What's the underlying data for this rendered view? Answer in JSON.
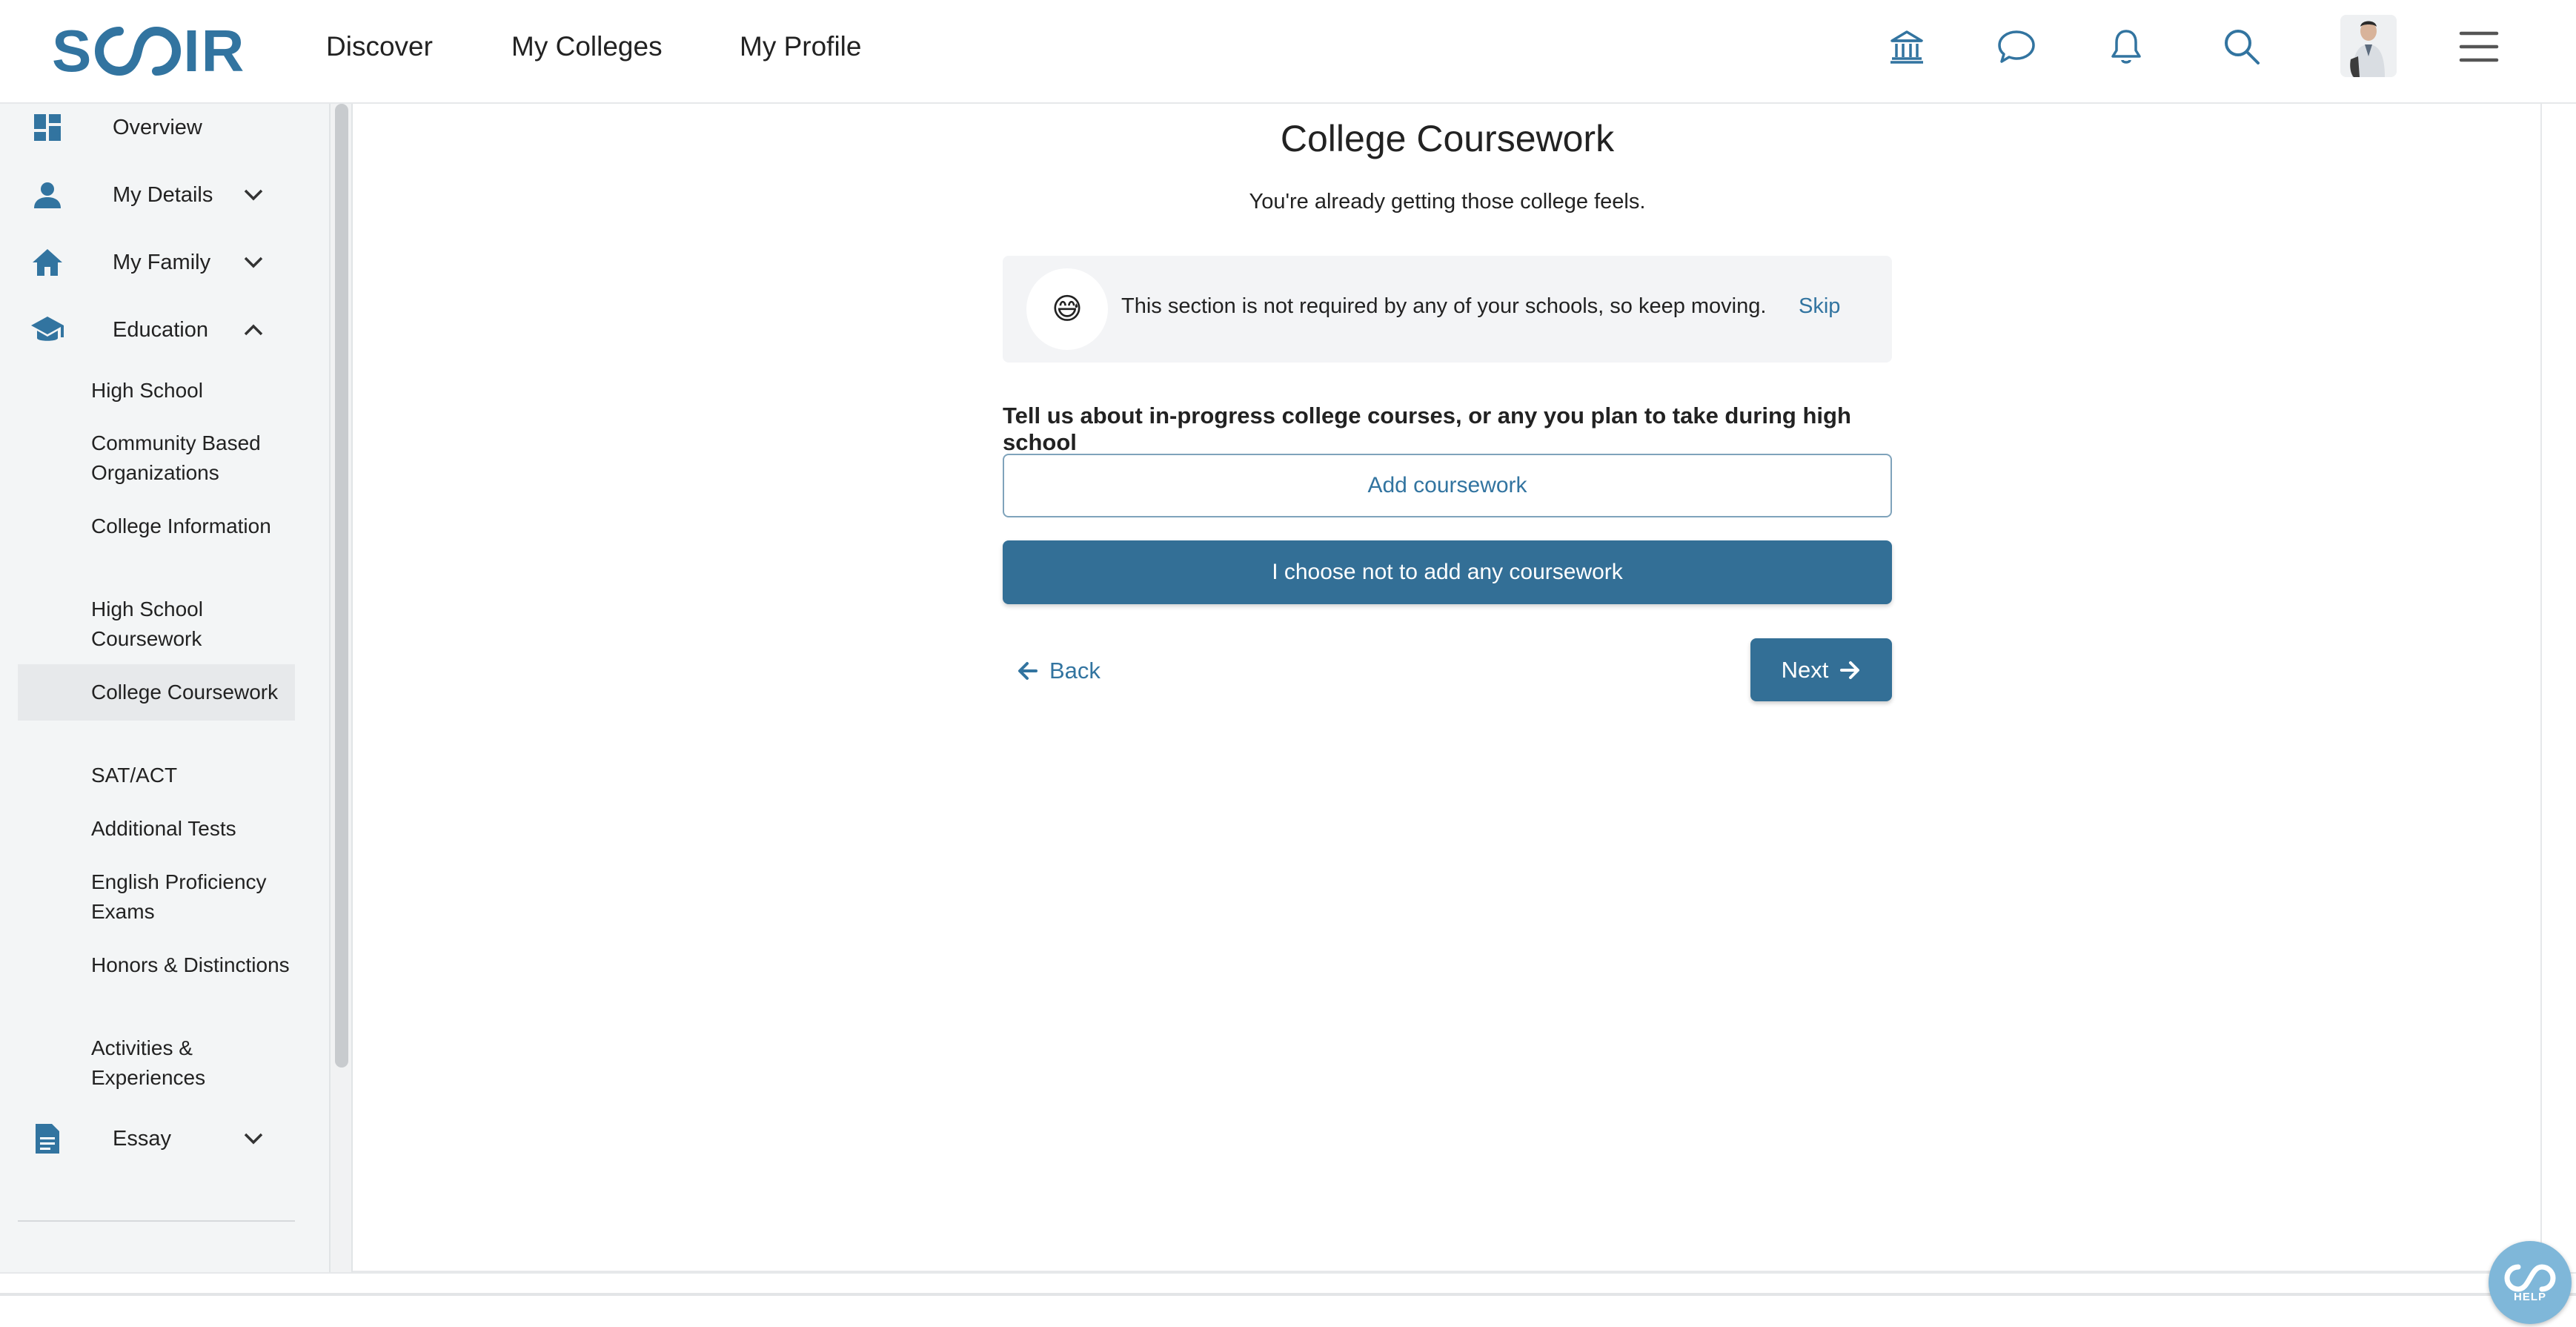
{
  "brand": {
    "logo_text": "SCOIR",
    "logo_left": "S",
    "logo_right": "IR",
    "color": "#3274a0"
  },
  "topnav": {
    "links": [
      "Discover",
      "My Colleges",
      "My Profile"
    ],
    "icons": [
      "college-icon",
      "chat-icon",
      "bell-icon",
      "search-icon",
      "avatar",
      "menu-icon"
    ]
  },
  "sidebar": {
    "sections": {
      "overview": "Overview",
      "my_details": "My Details",
      "my_family": "My Family",
      "education": "Education",
      "essay": "Essay"
    },
    "education_items": [
      "High School",
      "Community Based Organizations",
      "College Information",
      "High School Coursework",
      "College Coursework",
      "SAT/ACT",
      "Additional Tests",
      "English Proficiency Exams",
      "Honors & Distinctions",
      "Activities & Experiences"
    ],
    "active_item": "College Coursework"
  },
  "main": {
    "title": "College Coursework",
    "subtitle": "You're already getting those college feels.",
    "notice": {
      "emoji": "😅",
      "text": "This section is not required by any of your schools, so keep moving.",
      "skip_label": "Skip"
    },
    "prompt": "Tell us about in-progress college courses, or any you plan to take during high school",
    "add_button": "Add coursework",
    "decline_button": "I choose not to add any coursework",
    "back_label": "Back",
    "next_label": "Next"
  },
  "help": {
    "label": "HELP"
  },
  "colors": {
    "primary": "#336f96",
    "link": "#3274a0",
    "sidebar_bg": "#f3f5f6"
  }
}
